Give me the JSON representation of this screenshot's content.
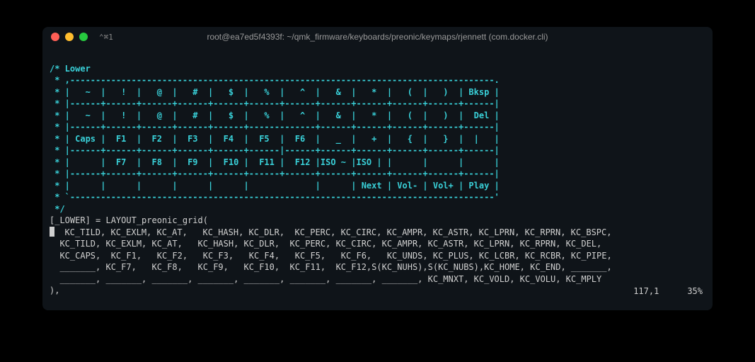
{
  "titlebar": {
    "shortcut": "⌃⌘1",
    "title": "root@ea7ed5f4393f: ~/qmk_firmware/keyboards/preonic/keymaps/rjennett (com.docker.cli)"
  },
  "comment_lines": [
    "/* Lower",
    " * ,-----------------------------------------------------------------------------------.",
    " * |   ~  |   !  |   @  |   #  |   $  |   %  |   ^  |   &  |   *  |   (  |   )  | Bksp |",
    " * |------+------+------+------+------+------+------+------+------+------+------+------|",
    " * |   ~  |   !  |   @  |   #  |   $  |   %  |   ^  |   &  |   *  |   (  |   )  |  Del |",
    " * |------+------+------+------+------+-------------+------+------+------+------+------|",
    " * | Caps |  F1  |  F2  |  F3  |  F4  |  F5  |  F6  |   _  |   +  |   {  |   }  |  |   |",
    " * |------+------+------+------+------+------|------+------+------+------+------+------|",
    " * |      |  F7  |  F8  |  F9  |  F10 |  F11 |  F12 |ISO ~ |ISO | |      |      |      |",
    " * |------+------+------+------+------+------+------+------+------+------+------+------|",
    " * |      |      |      |      |      |             |      | Next | Vol- | Vol+ | Play |",
    " * `-----------------------------------------------------------------------------------'",
    " */"
  ],
  "code_lines": [
    "[_LOWER] = LAYOUT_preonic_grid(",
    "  KC_TILD, KC_EXLM, KC_AT,   KC_HASH, KC_DLR,  KC_PERC, KC_CIRC, KC_AMPR, KC_ASTR, KC_LPRN, KC_RPRN, KC_BSPC,",
    "  KC_TILD, KC_EXLM, KC_AT,   KC_HASH, KC_DLR,  KC_PERC, KC_CIRC, KC_AMPR, KC_ASTR, KC_LPRN, KC_RPRN, KC_DEL,",
    "  KC_CAPS,  KC_F1,   KC_F2,   KC_F3,   KC_F4,   KC_F5,   KC_F6,   KC_UNDS, KC_PLUS, KC_LCBR, KC_RCBR, KC_PIPE,",
    "  _______, KC_F7,   KC_F8,   KC_F9,   KC_F10,  KC_F11,  KC_F12,S(KC_NUHS),S(KC_NUBS),KC_HOME, KC_END, _______,",
    "  _______, _______, _______, _______, _______, _______, _______, _______, KC_MNXT, KC_VOLD, KC_VOLU, KC_MPLY",
    "),"
  ],
  "status": {
    "pos": "117,1",
    "pct": "35%"
  }
}
